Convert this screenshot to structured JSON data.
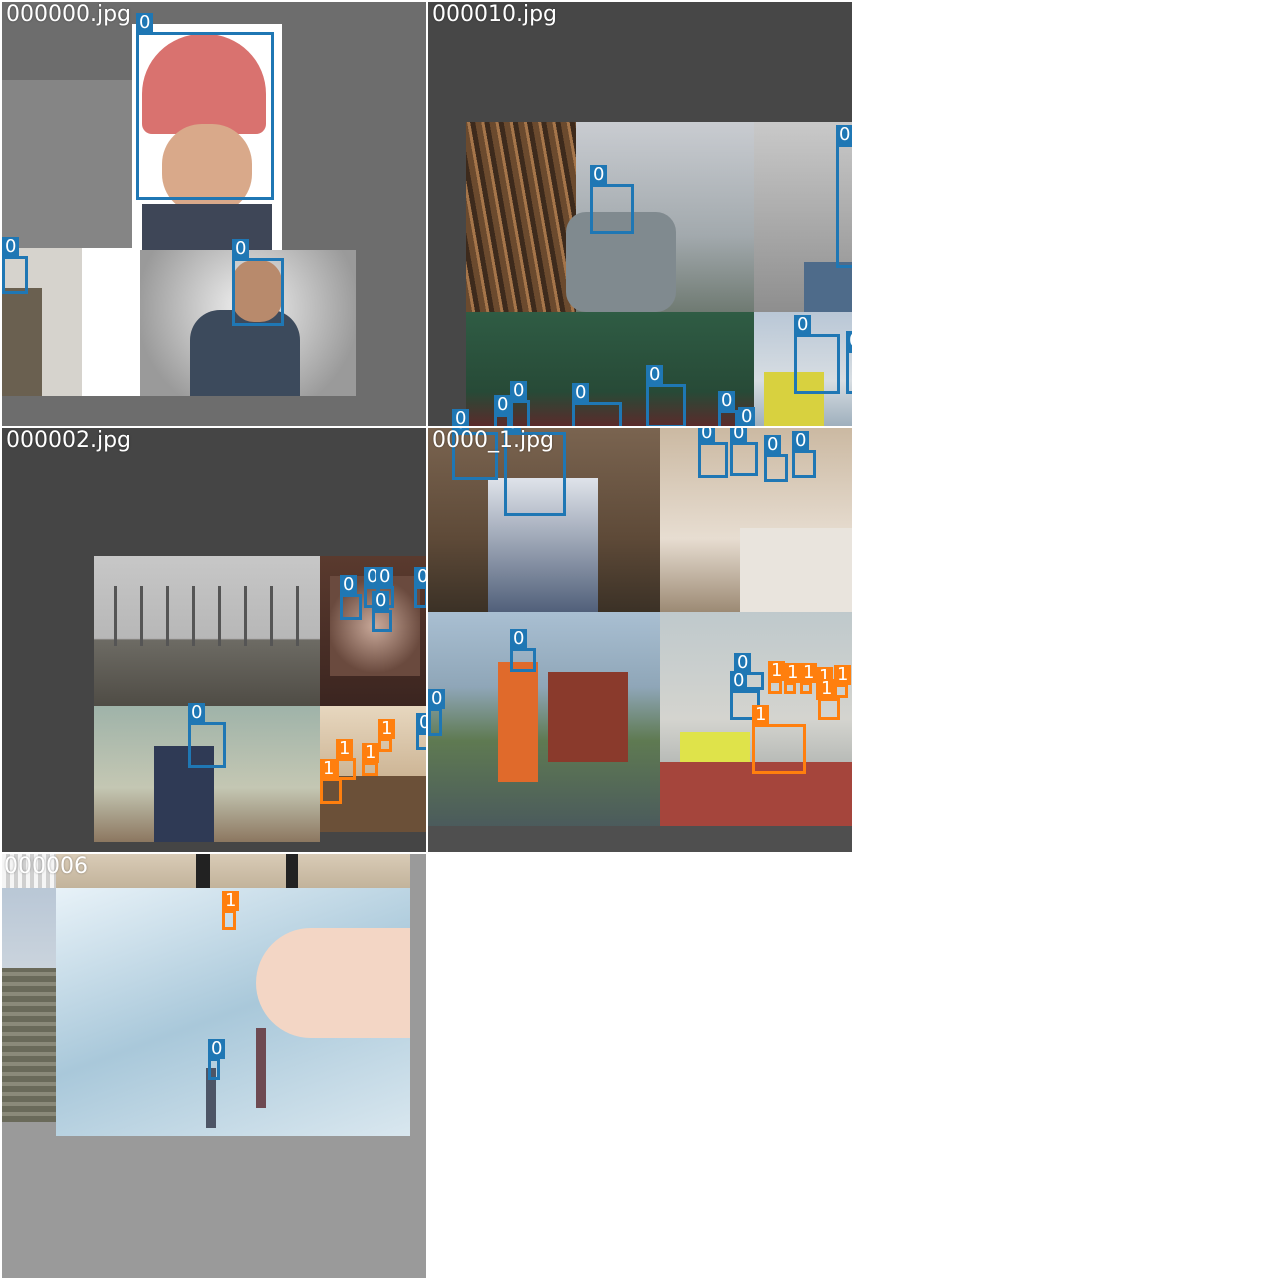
{
  "tiles": [
    {
      "label": "000000.jpg"
    },
    {
      "label": "000010.jpg"
    },
    {
      "label": "000002.jpg"
    },
    {
      "label": "0000_1.jpg"
    },
    {
      "label": "000006"
    }
  ],
  "class_labels": {
    "helmet": "0",
    "head": "1"
  },
  "colors": {
    "class0": "#1f77b4",
    "class1": "#ff7f0e"
  }
}
